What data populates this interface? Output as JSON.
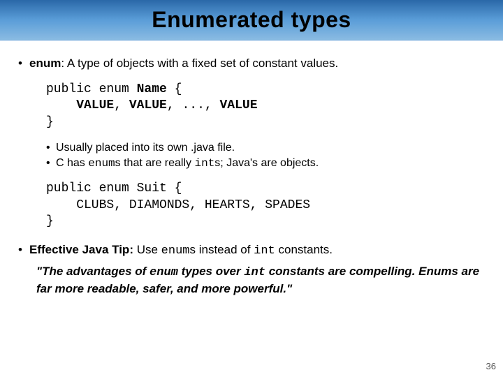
{
  "title": "Enumerated types",
  "def_term": "enum",
  "def_rest": ": A type of objects with a fixed set of constant values.",
  "code1": "public enum Name {\n    VALUE, VALUE, ..., VALUE\n}",
  "sub1_a": "Usually placed into its own .java file.",
  "sub2_a": "C has ",
  "sub2_b": "enum",
  "sub2_c": "s that are really ",
  "sub2_d": "int",
  "sub2_e": "s; Java's are objects.",
  "code2": "public enum Suit {\n    CLUBS, DIAMONDS, HEARTS, SPADES\n}",
  "tip_a": "Effective Java Tip:",
  "tip_b": " Use ",
  "tip_c": "enum",
  "tip_d": "s instead of ",
  "tip_e": "int",
  "tip_f": " constants.",
  "quote_a": "\"The advantages of ",
  "quote_b": "enum",
  "quote_c": " types over ",
  "quote_d": "int",
  "quote_e": " constants are compelling. Enums are far more readable, safer, and more powerful.\"",
  "slide_number": "36"
}
